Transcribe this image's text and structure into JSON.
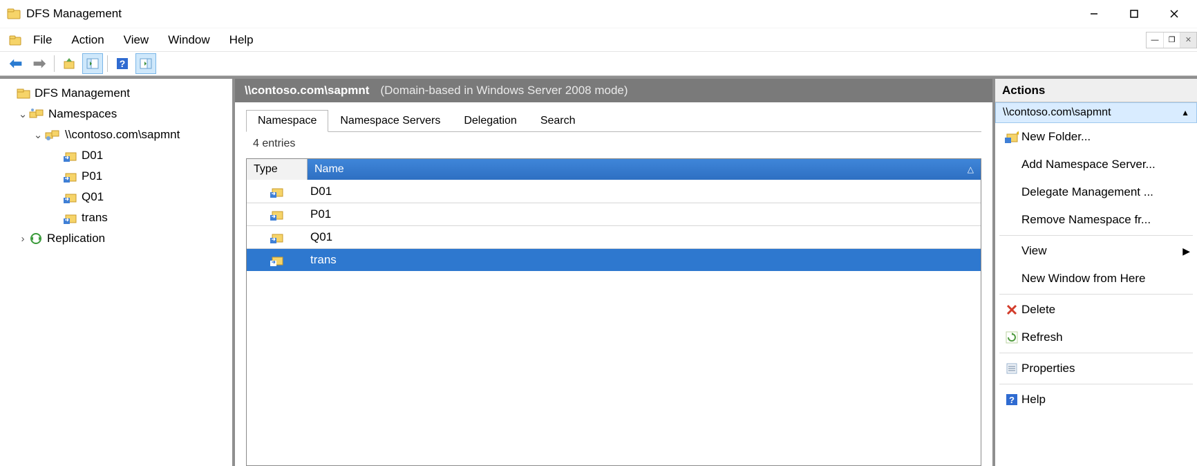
{
  "title": "DFS Management",
  "menubar": {
    "file": "File",
    "action": "Action",
    "view": "View",
    "window": "Window",
    "help": "Help"
  },
  "tree": {
    "root": "DFS Management",
    "namespaces": "Namespaces",
    "namespace_path": "\\\\contoso.com\\sapmnt",
    "children": [
      "D01",
      "P01",
      "Q01",
      "trans"
    ],
    "replication": "Replication"
  },
  "center": {
    "path": "\\\\contoso.com\\sapmnt",
    "mode": "(Domain-based in Windows Server 2008 mode)",
    "tabs": {
      "namespace": "Namespace",
      "servers": "Namespace Servers",
      "delegation": "Delegation",
      "search": "Search"
    },
    "entries_label": "4 entries",
    "columns": {
      "type": "Type",
      "name": "Name"
    },
    "rows": [
      "D01",
      "P01",
      "Q01",
      "trans"
    ],
    "selected_index": 3
  },
  "actions": {
    "title": "Actions",
    "section": "\\\\contoso.com\\sapmnt",
    "items": {
      "new_folder": "New Folder...",
      "add_server": "Add Namespace Server...",
      "delegate": "Delegate Management ...",
      "remove": "Remove Namespace fr...",
      "view": "View",
      "new_window": "New Window from Here",
      "delete": "Delete",
      "refresh": "Refresh",
      "properties": "Properties",
      "help": "Help"
    }
  }
}
